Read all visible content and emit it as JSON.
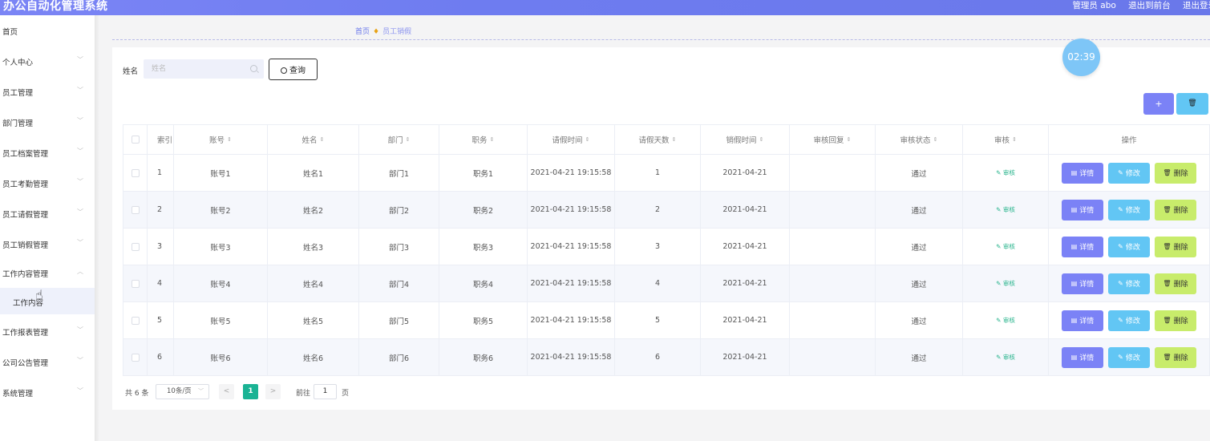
{
  "header": {
    "title": "办公自动化管理系统",
    "user": "管理员 abo",
    "back_to_front": "退出到前台",
    "logout": "退出登录"
  },
  "sidebar": {
    "items": [
      {
        "label": "首页",
        "has_arrow": false
      },
      {
        "label": "个人中心",
        "has_arrow": true
      },
      {
        "label": "员工管理",
        "has_arrow": true
      },
      {
        "label": "部门管理",
        "has_arrow": true
      },
      {
        "label": "员工档案管理",
        "has_arrow": true
      },
      {
        "label": "员工考勤管理",
        "has_arrow": true
      },
      {
        "label": "员工请假管理",
        "has_arrow": true
      },
      {
        "label": "员工销假管理",
        "has_arrow": true
      },
      {
        "label": "工作内容管理",
        "has_arrow": true,
        "expanded": true
      },
      {
        "label": "工作报表管理",
        "has_arrow": true
      },
      {
        "label": "公司公告管理",
        "has_arrow": true
      },
      {
        "label": "系统管理",
        "has_arrow": true
      }
    ],
    "sub_item": "工作内容"
  },
  "breadcrumb": {
    "home": "首页",
    "current": "员工销假"
  },
  "search": {
    "label": "姓名",
    "placeholder": "姓名",
    "query_label": "查询"
  },
  "clock": "02:39",
  "toolbar": {
    "add_label": "+",
    "delete_label": "🗑"
  },
  "table": {
    "columns": [
      "索引",
      "账号",
      "姓名",
      "部门",
      "职务",
      "请假时间",
      "请假天数",
      "销假时间",
      "审核回复",
      "审核状态",
      "审核",
      "操作"
    ],
    "rows": [
      {
        "index": "1",
        "account": "账号1",
        "name": "姓名1",
        "dept": "部门1",
        "position": "职务1",
        "leave_time": "2021-04-21 19:15:58",
        "days": "1",
        "cancel_time": "2021-04-21",
        "reply": "",
        "status": "通过"
      },
      {
        "index": "2",
        "account": "账号2",
        "name": "姓名2",
        "dept": "部门2",
        "position": "职务2",
        "leave_time": "2021-04-21 19:15:58",
        "days": "2",
        "cancel_time": "2021-04-21",
        "reply": "",
        "status": "通过"
      },
      {
        "index": "3",
        "account": "账号3",
        "name": "姓名3",
        "dept": "部门3",
        "position": "职务3",
        "leave_time": "2021-04-21 19:15:58",
        "days": "3",
        "cancel_time": "2021-04-21",
        "reply": "",
        "status": "通过"
      },
      {
        "index": "4",
        "account": "账号4",
        "name": "姓名4",
        "dept": "部门4",
        "position": "职务4",
        "leave_time": "2021-04-21 19:15:58",
        "days": "4",
        "cancel_time": "2021-04-21",
        "reply": "",
        "status": "通过"
      },
      {
        "index": "5",
        "account": "账号5",
        "name": "姓名5",
        "dept": "部门5",
        "position": "职务5",
        "leave_time": "2021-04-21 19:15:58",
        "days": "5",
        "cancel_time": "2021-04-21",
        "reply": "",
        "status": "通过"
      },
      {
        "index": "6",
        "account": "账号6",
        "name": "姓名6",
        "dept": "部门6",
        "position": "职务6",
        "leave_time": "2021-04-21 19:15:58",
        "days": "6",
        "cancel_time": "2021-04-21",
        "reply": "",
        "status": "通过"
      }
    ],
    "audit_link": "审核",
    "detail_label": "详情",
    "edit_label": "修改",
    "delete_label": "删除"
  },
  "pagination": {
    "total": "共 6 条",
    "page_size": "10条/页",
    "current_page": "1",
    "goto_label": "前往",
    "goto_value": "1",
    "page_suffix": "页"
  },
  "colors": {
    "header_bg": "#6e7cf0",
    "detail_btn": "#7b82f6",
    "edit_btn": "#62c6f4",
    "delete_btn": "#c8ec6b",
    "page_active": "#1ab394",
    "audit_link": "#28b48c"
  }
}
